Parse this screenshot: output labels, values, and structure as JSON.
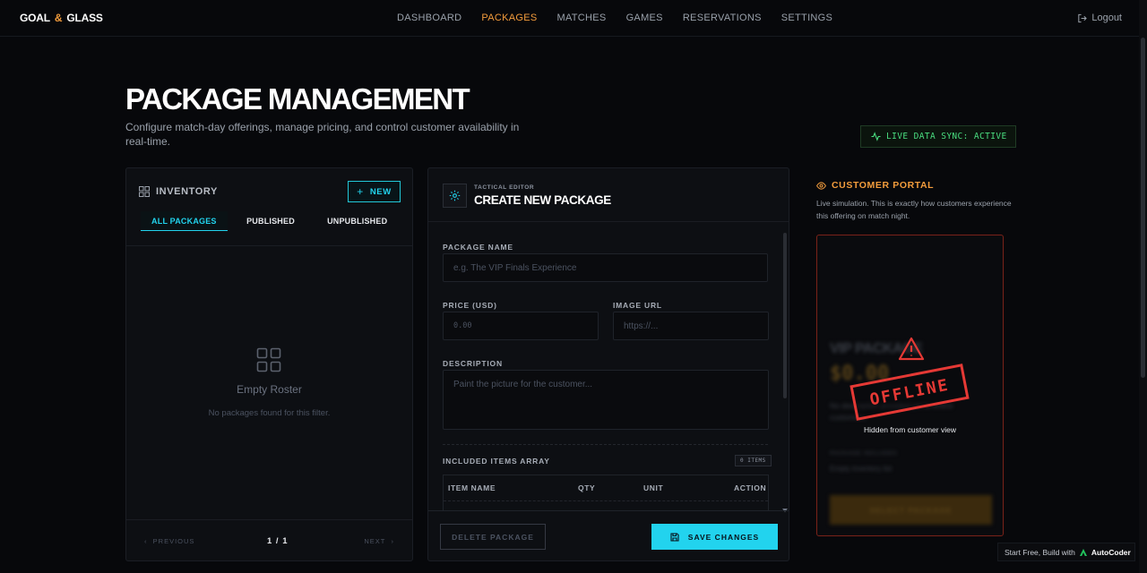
{
  "brand": {
    "left": "GOAL",
    "amp": "&",
    "right": "GLASS"
  },
  "nav": {
    "items": [
      "DASHBOARD",
      "PACKAGES",
      "MATCHES",
      "GAMES",
      "RESERVATIONS",
      "SETTINGS"
    ],
    "active": "PACKAGES",
    "logout": "Logout"
  },
  "header": {
    "title": "PACKAGE MANAGEMENT",
    "subtitle": "Configure match-day offerings, manage pricing, and control customer availability in real-time.",
    "sync_status": "LIVE DATA SYNC: ACTIVE"
  },
  "inventory": {
    "title": "INVENTORY",
    "new_label": "NEW",
    "tabs": [
      "ALL PACKAGES",
      "PUBLISHED",
      "UNPUBLISHED"
    ],
    "active_tab": "ALL PACKAGES",
    "empty_title": "Empty Roster",
    "empty_subtitle": "No packages found for this filter.",
    "prev_label": "PREVIOUS",
    "next_label": "NEXT",
    "pager": "1 / 1"
  },
  "editor": {
    "kicker": "TACTICAL EDITOR",
    "title": "CREATE NEW PACKAGE",
    "package_name": {
      "label": "PACKAGE NAME",
      "placeholder": "e.g. The VIP Finals Experience",
      "value": ""
    },
    "price": {
      "label": "PRICE (USD)",
      "placeholder": "0.00",
      "value": ""
    },
    "image_url": {
      "label": "IMAGE URL",
      "placeholder": "https://...",
      "value": ""
    },
    "description": {
      "label": "DESCRIPTION",
      "placeholder": "Paint the picture for the customer...",
      "value": ""
    },
    "items": {
      "label": "INCLUDED ITEMS ARRAY",
      "count_badge": "0 ITEMS",
      "columns": [
        "ITEM NAME",
        "QTY",
        "UNIT",
        "ACTION"
      ]
    },
    "delete_label": "DELETE PACKAGE",
    "save_label": "SAVE CHANGES"
  },
  "portal": {
    "title": "CUSTOMER PORTAL",
    "description": "Live simulation. This is exactly how customers experience this offering on match night.",
    "preview": {
      "name": "VIP PACKAGE",
      "price": "$0.00",
      "text": "No description provided yet to entice customers.",
      "includes_label": "PACKAGE INCLUDES",
      "includes_value": "Empty inventory list",
      "select_label": "SELECT PACKAGE"
    },
    "stamp": "OFFLINE",
    "hidden_text": "Hidden from customer view"
  },
  "footer_badge": {
    "prefix": "Start Free, Build with",
    "brand": "AutoCoder"
  },
  "colors": {
    "accent": "#22d3ee",
    "brand": "#f39c3c",
    "danger": "#e53935",
    "success": "#4ade80"
  }
}
